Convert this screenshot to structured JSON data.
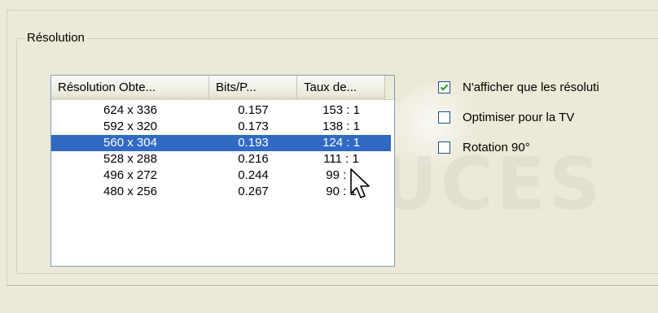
{
  "group": {
    "legend": "Résolution"
  },
  "listview": {
    "columns": [
      "Résolution Obte...",
      "Bits/P...",
      "Taux de..."
    ],
    "rows": [
      {
        "resolution": "624 x 336",
        "bits": "0.157",
        "taux": "153 : 1",
        "selected": false
      },
      {
        "resolution": "592 x 320",
        "bits": "0.173",
        "taux": "138 : 1",
        "selected": false
      },
      {
        "resolution": "560 x 304",
        "bits": "0.193",
        "taux": "124 : 1",
        "selected": true
      },
      {
        "resolution": "528 x 288",
        "bits": "0.216",
        "taux": "111 : 1",
        "selected": false
      },
      {
        "resolution": "496 x 272",
        "bits": "0.244",
        "taux": "99 : 1",
        "selected": false
      },
      {
        "resolution": "480 x 256",
        "bits": "0.267",
        "taux": "90 : 1",
        "selected": false
      }
    ]
  },
  "options": [
    {
      "label": "N'afficher que les résoluti",
      "checked": true
    },
    {
      "label": "Optimiser pour la TV",
      "checked": false
    },
    {
      "label": "Rotation 90°",
      "checked": false
    }
  ],
  "watermark": {
    "text": "PCASTUCES"
  },
  "colors": {
    "selection": "#316ac5",
    "dialog_bg": "#ece9d8",
    "checkbox_border": "#1c5180"
  },
  "icons": {
    "cursor": "arrow-cursor-icon",
    "check": "checkmark-icon"
  }
}
